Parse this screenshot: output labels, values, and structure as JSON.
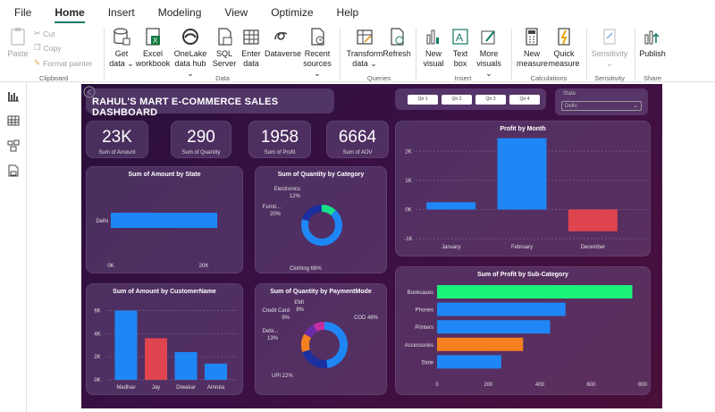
{
  "menu": {
    "items": [
      "File",
      "Home",
      "Insert",
      "Modeling",
      "View",
      "Optimize",
      "Help"
    ],
    "active": "Home"
  },
  "ribbon": {
    "clipboard": {
      "paste": "Paste",
      "cut": "Cut",
      "copy": "Copy",
      "format_painter": "Format painter",
      "group": "Clipboard"
    },
    "data": {
      "get_data": "Get data ⌄",
      "excel": "Excel workbook",
      "onelake": "OneLake data hub ⌄",
      "sql": "SQL Server",
      "enter": "Enter data",
      "dataverse": "Dataverse",
      "recent": "Recent sources ⌄",
      "group": "Data"
    },
    "queries": {
      "transform": "Transform data ⌄",
      "refresh": "Refresh",
      "group": "Queries"
    },
    "insert": {
      "new_visual": "New visual",
      "text_box": "Text box",
      "more_visuals": "More visuals ⌄",
      "group": "Insert"
    },
    "calculations": {
      "new_measure": "New measure",
      "quick_measure": "Quick measure",
      "group": "Calculations"
    },
    "sensitivity": {
      "label": "Sensitivity ⌄",
      "group": "Sensitivity"
    },
    "share": {
      "publish": "Publish",
      "group": "Share"
    }
  },
  "dashboard": {
    "title": "RAHUL'S MART E-COMMERCE SALES DASHBOARD",
    "quarters": [
      "Qtr 1",
      "Qtr 2",
      "Qtr 3",
      "Qtr 4"
    ],
    "state_slicer": {
      "label": "State",
      "value": "Delhi"
    },
    "kpis": [
      {
        "value": "23K",
        "label": "Sum of Amount"
      },
      {
        "value": "290",
        "label": "Sum of Quantity"
      },
      {
        "value": "1958",
        "label": "Sum of Profit"
      },
      {
        "value": "6664",
        "label": "Sum of AOV"
      }
    ],
    "colors": {
      "blue": "#1f86f5",
      "red": "#e0444f",
      "green": "#1af27a",
      "orange": "#f5801f",
      "navy": "#1b2f9e",
      "purple": "#6b2aa8",
      "magenta": "#c030a0",
      "teal": "#18e08a"
    }
  },
  "chart_data": [
    {
      "type": "bar",
      "title": "Sum of Amount by State",
      "orientation": "horizontal",
      "categories": [
        "Delhi"
      ],
      "values": [
        22900
      ],
      "xticks": [
        "0K",
        "20K"
      ],
      "xlim": [
        0,
        25000
      ]
    },
    {
      "type": "pie",
      "title": "Sum of Quantity by Category",
      "donut": true,
      "labels": [
        "Clothing",
        "Furniture",
        "Electronics"
      ],
      "label_texts": [
        "Clothing 68%",
        "Furnit... 20%",
        "Electronics 12%"
      ],
      "values": [
        68,
        20,
        12
      ]
    },
    {
      "type": "bar",
      "title": "Profit by Month",
      "categories": [
        "January",
        "February",
        "December"
      ],
      "values": [
        250,
        2450,
        -750
      ],
      "yticks": [
        "2K",
        "1K",
        "0K",
        "-1K"
      ],
      "ylim": [
        -1000,
        2500
      ]
    },
    {
      "type": "bar",
      "title": "Sum of Amount by CustomerName",
      "categories": [
        "Madhav",
        "Jay",
        "Diwakar",
        "Amruta"
      ],
      "values": [
        6000,
        3600,
        2400,
        1400
      ],
      "yticks": [
        "6K",
        "4K",
        "2K",
        "0K"
      ],
      "ylim": [
        0,
        6500
      ]
    },
    {
      "type": "pie",
      "title": "Sum of Quantity by PaymentMode",
      "donut": true,
      "labels": [
        "COD",
        "UPI",
        "Debit Card",
        "Credit Card",
        "EMI"
      ],
      "label_texts": [
        "COD 48%",
        "UPI 22%",
        "Debi... 13%",
        "Credit Card 9%",
        "EMI 8%"
      ],
      "values": [
        48,
        22,
        13,
        9,
        8
      ]
    },
    {
      "type": "bar",
      "title": "Sum of Profit by Sub-Category",
      "orientation": "horizontal",
      "categories": [
        "Bookcases",
        "Phones",
        "Printers",
        "Accessories",
        "Stole"
      ],
      "values": [
        760,
        500,
        440,
        335,
        250
      ],
      "xticks": [
        "0",
        "200",
        "400",
        "600",
        "800"
      ],
      "xlim": [
        0,
        800
      ]
    }
  ]
}
